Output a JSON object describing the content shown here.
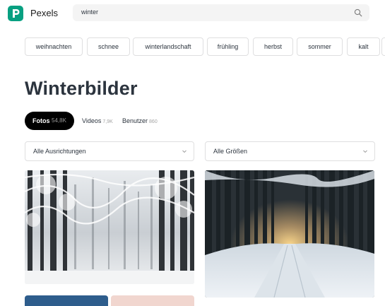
{
  "header": {
    "brand": "Pexels",
    "search_value": "winter",
    "logo_icon": "pexels-logo-icon",
    "search_icon": "search-icon",
    "brand_color": "#07a081"
  },
  "chips": [
    "weihnachten",
    "schnee",
    "winterlandschaft",
    "frühling",
    "herbst",
    "sommer",
    "kalt"
  ],
  "page": {
    "title": "Winterbilder"
  },
  "tabs": [
    {
      "label": "Fotos",
      "count": "54,8K",
      "active": true
    },
    {
      "label": "Videos",
      "count": "7,9K",
      "active": false
    },
    {
      "label": "Benutzer",
      "count": "860",
      "active": false
    }
  ],
  "filters": {
    "orientation": "Alle Ausrichtungen",
    "size": "Alle Größen",
    "chevron_icon": "chevron-down-icon"
  },
  "photos": [
    {
      "name": "snowy-forest-photo"
    },
    {
      "name": "snowy-forest-road-photo"
    }
  ]
}
